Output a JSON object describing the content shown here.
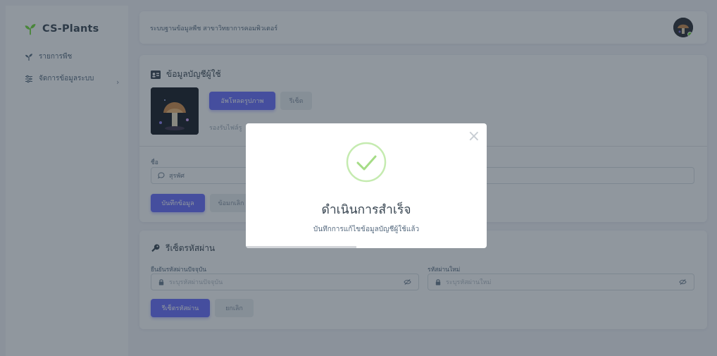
{
  "sidebar": {
    "brand": "CS-Plants",
    "items": [
      {
        "label": "รายการพืช",
        "icon": "plant-icon"
      },
      {
        "label": "จัดการข้อมูลระบบ",
        "icon": "sliders-icon",
        "chevron": "›"
      }
    ]
  },
  "topbar": {
    "title": "ระบบฐานข้อมูลพืช สาขาวิทยาการคอมพิวเตอร์"
  },
  "account": {
    "title": "ข้อมูลบัญชีผู้ใช้",
    "upload_label": "อัพโหลดรูปภาพ",
    "reset_label": "รีเซ็ต",
    "hint": "รองรับไฟล์รู",
    "name_label": "ชื่อ",
    "name_value": "สุรพัศ",
    "save_label": "บันทึกข้อมูล",
    "cancel_label": "ยกเลิก",
    "cancel_visible": "ข้อมกเลิก"
  },
  "password": {
    "title": "รีเซ็ตรหัสผ่าน",
    "current_label": "ยืนยันรหัสผ่านปัจจุบัน",
    "current_placeholder": "ระบุรหัสผ่านปัจจุบัน",
    "new_label": "รหัสผ่านใหม่",
    "new_placeholder": "ระบุรหัสผ่านใหม่",
    "reset_label": "รีเซ็ตรหัสผ่าน",
    "cancel_label": "ยกเลิก"
  },
  "modal": {
    "close": "×",
    "title": "ดำเนินการสำเร็จ",
    "message": "บันทึกการแก้ไขข้อมูลบัญชีผู้ใช้แล้ว",
    "progress": 0.46
  },
  "colors": {
    "primary": "#696cff",
    "brand_green": "#71dd37",
    "success": "#a5dc86"
  }
}
